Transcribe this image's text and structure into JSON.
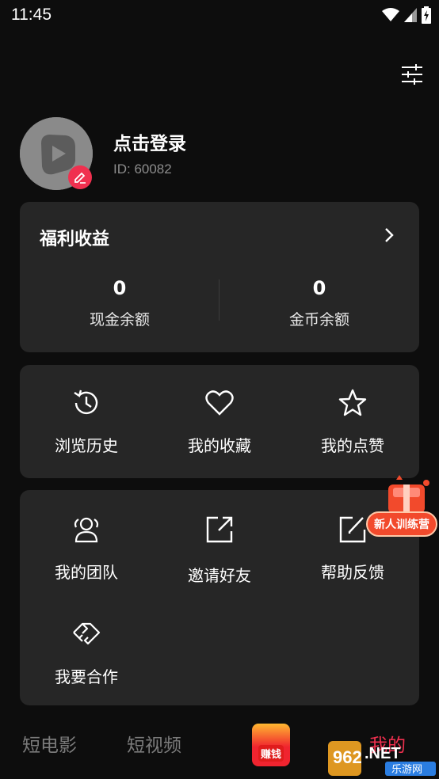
{
  "status_bar": {
    "time": "11:45"
  },
  "profile": {
    "login_text": "点击登录",
    "user_id": "ID: 60082"
  },
  "welfare": {
    "title": "福利收益",
    "cash": {
      "value": "0",
      "label": "现金余额"
    },
    "coins": {
      "value": "0",
      "label": "金币余额"
    }
  },
  "quick_actions": [
    {
      "label": "浏览历史",
      "icon": "history-icon"
    },
    {
      "label": "我的收藏",
      "icon": "heart-icon"
    },
    {
      "label": "我的点赞",
      "icon": "star-icon"
    }
  ],
  "tools": [
    {
      "label": "我的团队",
      "icon": "team-icon"
    },
    {
      "label": "邀请好友",
      "icon": "share-icon"
    },
    {
      "label": "帮助反馈",
      "icon": "edit-icon"
    },
    {
      "label": "我要合作",
      "icon": "handshake-icon"
    }
  ],
  "promo": {
    "label": "新人训练营"
  },
  "tabbar": {
    "tabs": [
      {
        "label": "短电影"
      },
      {
        "label": "短视频"
      },
      {
        "label": "赚钱"
      },
      {
        "label": "我的"
      }
    ],
    "active_color": "#f0304f"
  },
  "watermark": {
    "brand": "962.NET",
    "sub": "乐游网"
  },
  "colors": {
    "background": "#0d0d0d",
    "card": "#262626",
    "accent": "#f0304f"
  }
}
